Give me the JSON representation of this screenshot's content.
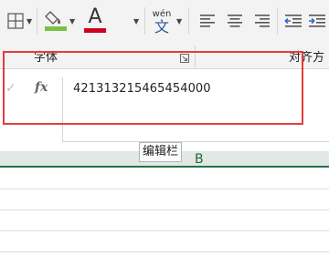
{
  "ribbon": {
    "icons": {
      "borders": "borders-icon",
      "fill_color": "fill-color-icon",
      "font_color": "font-color-icon",
      "phonetic": "phonetic-guide-icon",
      "align_left": "align-left-icon",
      "align_center": "align-center-icon",
      "align_right": "align-right-icon",
      "decrease_indent": "decrease-indent-icon",
      "increase_indent": "increase-indent-icon"
    },
    "font_color_letter": "A",
    "phonetic_top": "wén",
    "phonetic_bottom": "文",
    "colors": {
      "fill_highlight": "#7ac143",
      "font_underline": "#d0021b"
    },
    "font_group_label": "字体",
    "align_group_label": "对齐方"
  },
  "formula_bar": {
    "cancel_symbol": "✓",
    "fx_label": "fx",
    "value": "421313215465454000"
  },
  "tooltip": "编辑栏",
  "grid": {
    "column_b": "B",
    "accent": "#227447"
  },
  "annotation": {
    "highlight_color": "#e53c3c"
  }
}
